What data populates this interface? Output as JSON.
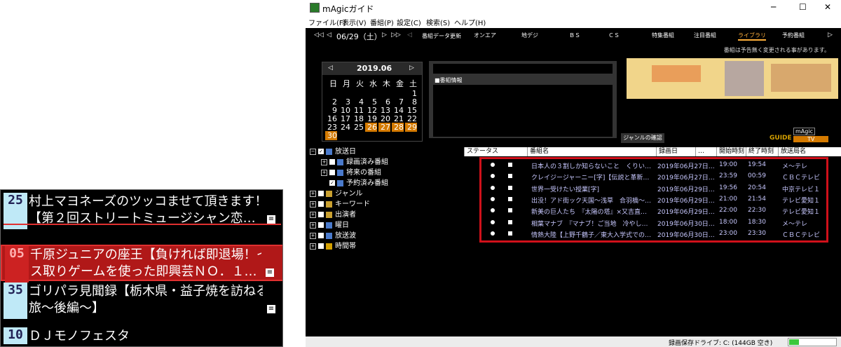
{
  "zoom": {
    "rows": [
      {
        "minute": "25",
        "line1": "村上マヨネーズのツッコませて頂きます！",
        "line2": "【第２回ストリートミュージシャン恋…",
        "style": "cyan"
      },
      {
        "minute": "05",
        "line1": "千原ジュニアの座王【負ければ即退場！イ",
        "line2": "ス取りゲームを使った即興芸ＮＯ．１…",
        "style": "red"
      },
      {
        "minute": "35",
        "line1": "ゴリパラ見聞録【栃木県・益子焼を訪ねる",
        "line2": "旅～後編～】",
        "style": "cyan"
      },
      {
        "minute": "10",
        "line1": "ＤＪモノフェスタ",
        "line2": "",
        "style": "cyan"
      }
    ]
  },
  "window": {
    "title": "mAgicガイド",
    "controls": {
      "minimize": "─",
      "maximize": "☐",
      "close": "✕"
    }
  },
  "menu": [
    "ファイル(F)",
    "表示(V)",
    "番組(P)",
    "設定(C)",
    "検索(S)",
    "ヘルプ(H)"
  ],
  "toolbar": {
    "date": "06/29（土）",
    "nav": {
      "first": "◁◁",
      "prev": "◁",
      "next": "▷",
      "last": "▷▷",
      "left_small": "◁",
      "right": "▷"
    },
    "update_label": "番組データ更新",
    "tabs": [
      "オンエア",
      "地デジ",
      "ＢＳ",
      "ＣＳ",
      "特集番組",
      "注目番組",
      "ライブラリ",
      "予約番組"
    ],
    "active_tab": "ライブラリ"
  },
  "notice": "番組は予告無く変更される事があります。",
  "calendar": {
    "month": "2019.06",
    "prev": "◁",
    "next": "▷",
    "weekdays": [
      "日",
      "月",
      "火",
      "水",
      "木",
      "金",
      "土"
    ],
    "weeks": [
      [
        "",
        "",
        "",
        "",
        "",
        "",
        "1"
      ],
      [
        "2",
        "3",
        "4",
        "5",
        "6",
        "7",
        "8"
      ],
      [
        "9",
        "10",
        "11",
        "12",
        "13",
        "14",
        "15"
      ],
      [
        "16",
        "17",
        "18",
        "19",
        "20",
        "21",
        "22"
      ],
      [
        "23",
        "24",
        "25",
        "26",
        "27",
        "28",
        "29"
      ],
      [
        "30",
        "",
        "",
        "",
        "",
        "",
        ""
      ]
    ],
    "highlighted": [
      "26",
      "27",
      "28",
      "29",
      "30"
    ]
  },
  "info_panel": {
    "label": "■番組情報",
    "genre_button": "ジャンルの確認"
  },
  "logo": {
    "top": "mAgic",
    "bottom": "TV",
    "left": "GUIDE"
  },
  "tree": [
    {
      "label": "放送日",
      "level": 0,
      "expander": "−",
      "checked": true
    },
    {
      "label": "録画済み番組",
      "level": 1,
      "expander": "+",
      "checked": false
    },
    {
      "label": "将来の番組",
      "level": 1,
      "expander": "+",
      "checked": false
    },
    {
      "label": "予約済み番組",
      "level": 1,
      "expander": "",
      "checked": true
    },
    {
      "label": "ジャンル",
      "level": 0,
      "expander": "+",
      "checked": false
    },
    {
      "label": "キーワード",
      "level": 0,
      "expander": "+",
      "checked": false
    },
    {
      "label": "出演者",
      "level": 0,
      "expander": "+",
      "checked": false
    },
    {
      "label": "曜日",
      "level": 0,
      "expander": "+",
      "checked": false
    },
    {
      "label": "放送波",
      "level": 0,
      "expander": "+",
      "checked": false
    },
    {
      "label": "時間帯",
      "level": 0,
      "expander": "+",
      "checked": false
    }
  ],
  "table": {
    "headers": [
      "ステータス",
      "番組名",
      "録画日",
      "…",
      "開始時刻",
      "終了時刻",
      "放送局名"
    ],
    "rows": [
      {
        "title": "日本人の３割しか知らないこと　くりい…",
        "date": "2019年06月27日…",
        "start": "19:00",
        "end": "19:54",
        "station": "メ～テレ"
      },
      {
        "title": "クレイジージャーニー[字]【伝説と革新…",
        "date": "2019年06月27日…",
        "start": "23:59",
        "end": "00:59",
        "station": "ＣＢＣテレビ"
      },
      {
        "title": "世界一受けたい授業[字]",
        "date": "2019年06月29日…",
        "start": "19:56",
        "end": "20:54",
        "station": "中京テレビ１"
      },
      {
        "title": "出没！アド街ック天国～浅草　合羽橋～…",
        "date": "2019年06月29日…",
        "start": "21:00",
        "end": "21:54",
        "station": "テレビ愛知１"
      },
      {
        "title": "新美の巨人たち　『太陽の塔』×又吉直…",
        "date": "2019年06月29日…",
        "start": "22:00",
        "end": "22:30",
        "station": "テレビ愛知１"
      },
      {
        "title": "相葉マナブ　『マナブ！ご当地　冷やし…",
        "date": "2019年06月30日…",
        "start": "18:00",
        "end": "18:30",
        "station": "メ～テレ"
      },
      {
        "title": "情熱大陸【上野千鶴子／東大入学式での…",
        "date": "2019年06月30日…",
        "start": "23:00",
        "end": "23:30",
        "station": "ＣＢＣテレビ"
      }
    ]
  },
  "statusbar": {
    "drive": "録画保存ドライブ: C:  (144GB 空き)"
  },
  "colors": {
    "accent": "#d47a00",
    "highlight_border": "#d0101a",
    "zoom_red": "#cc2222",
    "zoom_cyan": "#bfe9f7"
  }
}
